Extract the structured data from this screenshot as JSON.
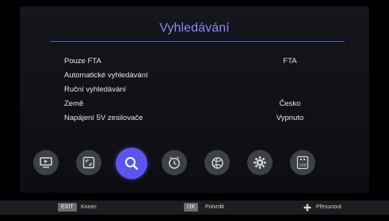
{
  "screen": {
    "title": "Vyhledávání"
  },
  "menu": [
    {
      "label": "Pouze FTA",
      "value": "FTA"
    },
    {
      "label": "Automatické vyhledávání",
      "value": ""
    },
    {
      "label": "Ruční vyhledávání",
      "value": ""
    },
    {
      "label": "Země",
      "value": "Česko"
    },
    {
      "label": "Napájení 5V zesilovače",
      "value": "Vypnuto"
    }
  ],
  "icons": [
    {
      "name": "tv-icon",
      "active": false
    },
    {
      "name": "picture-icon",
      "active": false
    },
    {
      "name": "search-icon",
      "active": true
    },
    {
      "name": "timer-icon",
      "active": false
    },
    {
      "name": "globe-icon",
      "active": false
    },
    {
      "name": "settings-icon",
      "active": false
    },
    {
      "name": "usb-icon",
      "active": false
    }
  ],
  "footer": {
    "exit_key": "EXIT",
    "exit_label": "Konec",
    "ok_key": "OK",
    "ok_label": "Potvrdit",
    "move_label": "Přesunout"
  },
  "colors": {
    "accent": "#5b55f0",
    "title": "#8d86ff",
    "icon_bg": "#3d4047",
    "background": "#000000"
  },
  "usb_icon_text": "USB"
}
